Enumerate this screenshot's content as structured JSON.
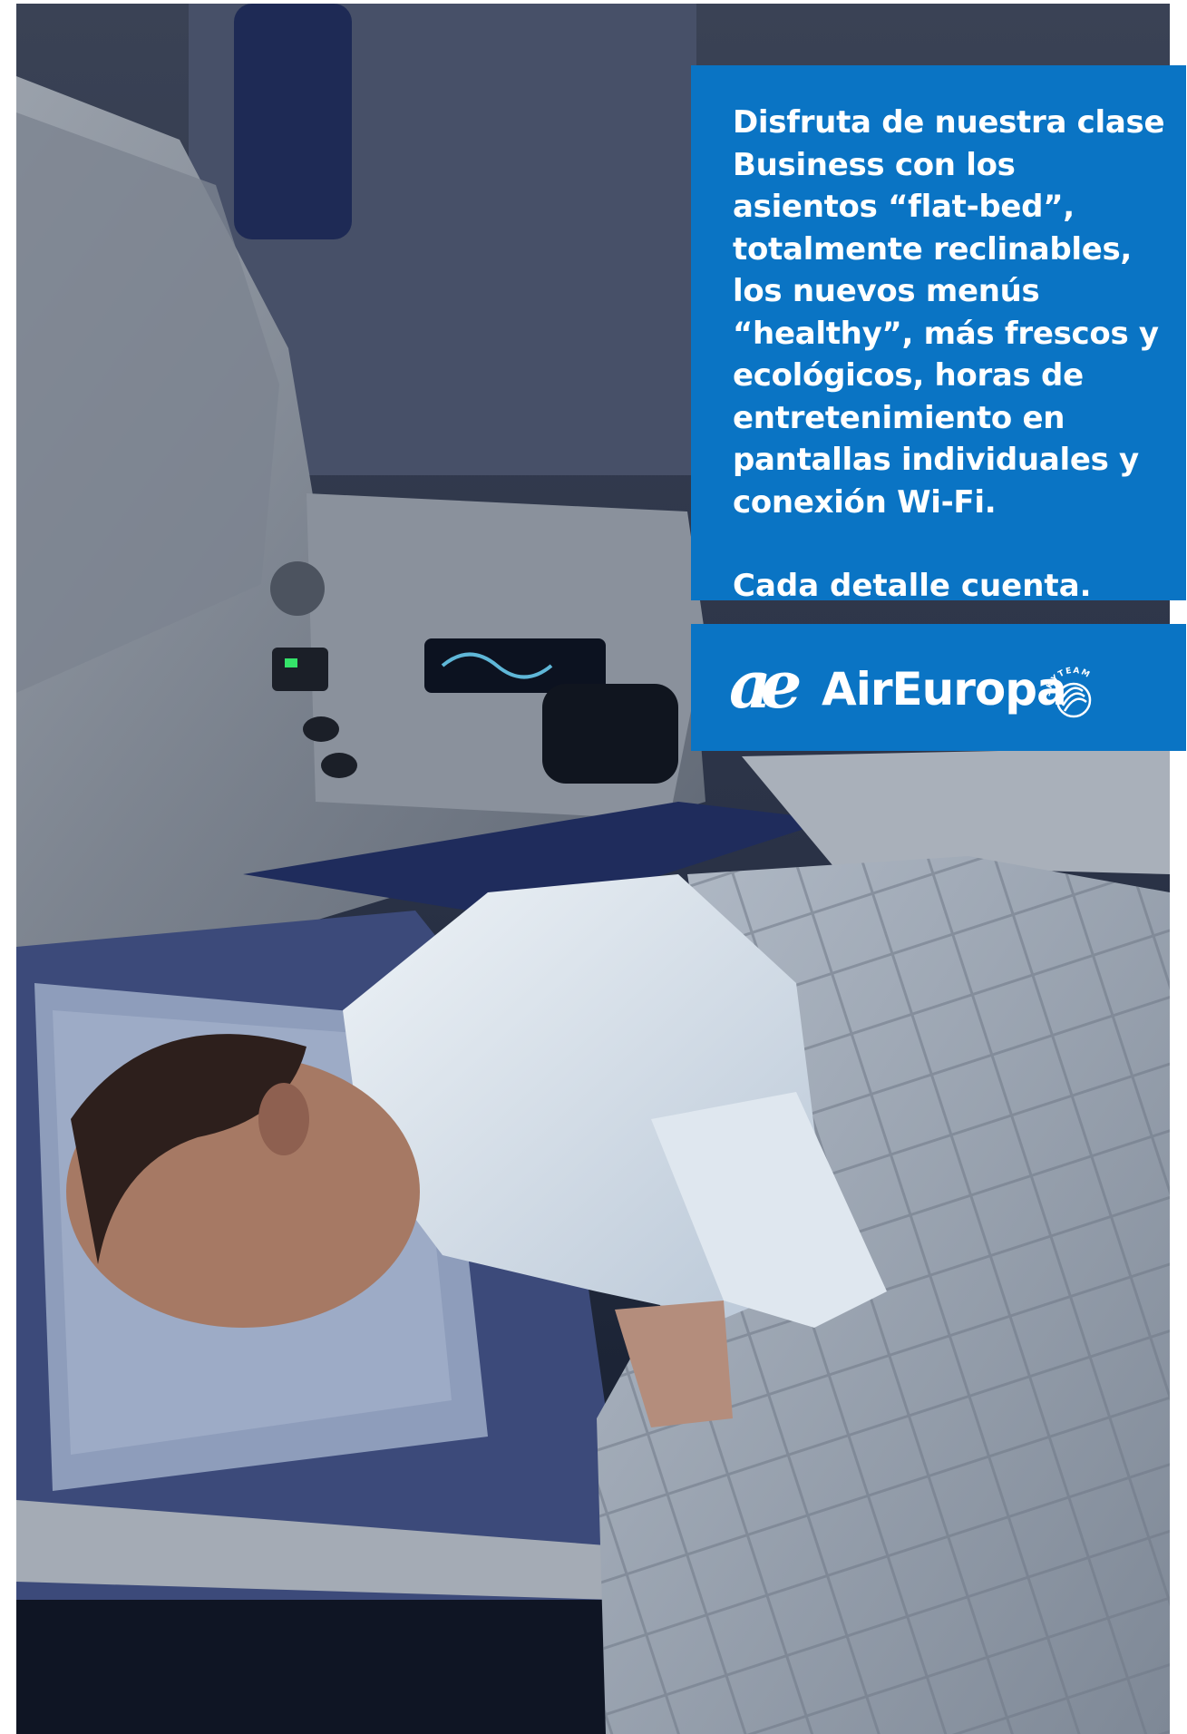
{
  "ad": {
    "headline": "Disfruta de nuestra clase Business con los asientos “flat-bed”, totalmente reclinables, los nuevos menús “healthy”, más frescos y ecológicos, horas de entretenimiento en pantallas individuales y conexión Wi-Fi.",
    "tagline": "Cada detalle cuenta.",
    "brand_name": "AirEuropa",
    "alliance_badge": "SKYTEAM"
  },
  "icons": {
    "brand_logo": "air-europa-ae-logo-icon",
    "alliance": "skyteam-logo-icon"
  },
  "colors": {
    "brand_blue": "#0a74c4",
    "text": "#ffffff"
  }
}
